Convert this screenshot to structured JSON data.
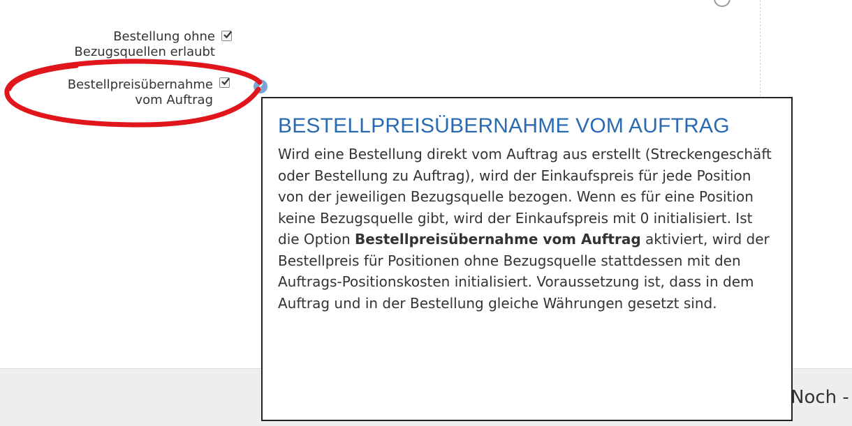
{
  "form": {
    "option_order_without_sources": {
      "label_line1": "Bestellung ohne",
      "label_line2": "Bezugsquellen erlaubt",
      "checked": true
    },
    "option_price_transfer": {
      "label_line1": "Bestellpreisübernahme",
      "label_line2": "vom Auftrag",
      "checked": true
    },
    "help_icon": "question-icon",
    "help_glyph": "?"
  },
  "tooltip": {
    "title": "BESTELLPREISÜBERNAHME VOM AUFTRAG",
    "body_part1": "Wird eine Bestellung direkt vom Auftrag aus erstellt (Streckengeschäft oder Bestellung zu Auftrag), wird der Einkaufspreis für jede Position von der jeweiligen Bezugsquelle bezogen. Wenn es für eine Position keine Bezugsquelle gibt, wird der Einkaufspreis mit 0 initialisiert. Ist die Option ",
    "body_bold": "Bestellpreisübernahme vom Auftrag",
    "body_part2": " aktiviert, wird der Bestellpreis für Positionen ohne Bezugsquelle stattdessen mit den Auftrags-Positionskosten initialisiert. Voraussetzung ist, dass in dem Auftrag und in der Bestellung gleiche Währungen gesetzt sind."
  },
  "footer": {
    "partial_text": "Noch -"
  },
  "colors": {
    "title": "#2a6ab1",
    "annotation": "#e0161c",
    "help_icon": "#7aa6d6"
  }
}
